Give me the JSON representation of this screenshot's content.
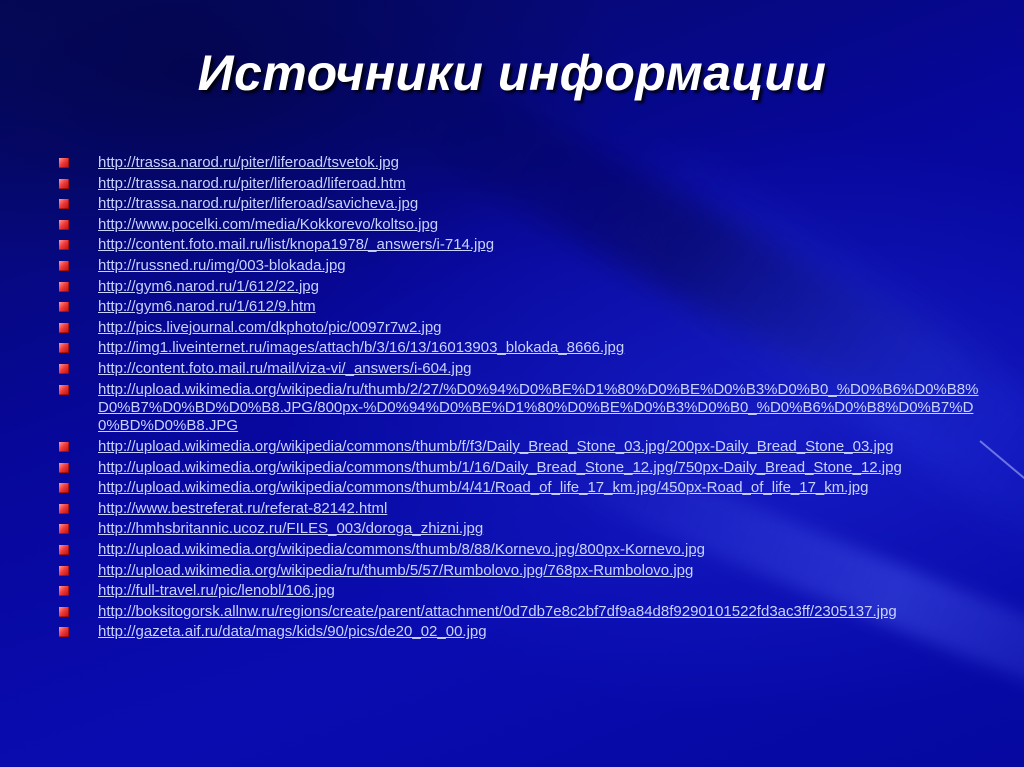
{
  "slide": {
    "title": "Источники информации",
    "colors": {
      "background": "#05068a",
      "title": "#ffffff",
      "link": "#c9d2ff",
      "bullet": "#f03a3a"
    },
    "bullet_icon": "red-square-bullet",
    "sources": [
      {
        "text": "http://trassa.narod.ru/piter/liferoad/tsvetok.jpg"
      },
      {
        "text": "http://trassa.narod.ru/piter/liferoad/liferoad.htm"
      },
      {
        "text": "http://trassa.narod.ru/piter/liferoad/savicheva.jpg"
      },
      {
        "text": "http://www.pocelki.com/media/Kokkorevo/koltso.jpg"
      },
      {
        "text": "http://content.foto.mail.ru/list/knopa1978/_answers/i-714.jpg"
      },
      {
        "text": "http://russned.ru/img/003-blokada.jpg"
      },
      {
        "text": "http://gym6.narod.ru/1/612/22.jpg"
      },
      {
        "text": "http://gym6.narod.ru/1/612/9.htm"
      },
      {
        "text": "http://pics.livejournal.com/dkphoto/pic/0097r7w2.jpg"
      },
      {
        "text": "http://img1.liveinternet.ru/images/attach/b/3/16/13/16013903_blokada_8666.jpg"
      },
      {
        "text": "http://content.foto.mail.ru/mail/viza-vi/_answers/i-604.jpg"
      },
      {
        "text": "http://upload.wikimedia.org/wikipedia/ru/thumb/2/27/%D0%94%D0%BE%D1%80%D0%BE%D0%B3%D0%B0_%D0%B6%D0%B8%D0%B7%D0%BD%D0%B8.JPG/800px-%D0%94%D0%BE%D1%80%D0%BE%D0%B3%D0%B0_%D0%B6%D0%B8%D0%B7%D0%BD%D0%B8.JPG"
      },
      {
        "text": "http://upload.wikimedia.org/wikipedia/commons/thumb/f/f3/Daily_Bread_Stone_03.jpg/200px-Daily_Bread_Stone_03.jpg"
      },
      {
        "text": "http://upload.wikimedia.org/wikipedia/commons/thumb/1/16/Daily_Bread_Stone_12.jpg/750px-Daily_Bread_Stone_12.jpg"
      },
      {
        "text": "http://upload.wikimedia.org/wikipedia/commons/thumb/4/41/Road_of_life_17_km.jpg/450px-Road_of_life_17_km.jpg"
      },
      {
        "text": "http://www.bestreferat.ru/referat-82142.html"
      },
      {
        "text": "http://hmhsbritannic.ucoz.ru/FILES_003/doroga_zhizni.jpg"
      },
      {
        "text": "http://upload.wikimedia.org/wikipedia/commons/thumb/8/88/Kornevo.jpg/800px-Kornevo.jpg"
      },
      {
        "text": "http://upload.wikimedia.org/wikipedia/ru/thumb/5/57/Rumbolovo.jpg/768px-Rumbolovo.jpg"
      },
      {
        "text": "http://full-travel.ru/pic/lenobl/106.jpg"
      },
      {
        "text": "http://boksitogorsk.allnw.ru/regions/create/parent/attachment/0d7db7e8c2bf7df9a84d8f9290101522fd3ac3ff/2305137.jpg"
      },
      {
        "text": "http://gazeta.aif.ru/data/mags/kids/90/pics/de20_02_00.jpg"
      }
    ]
  }
}
